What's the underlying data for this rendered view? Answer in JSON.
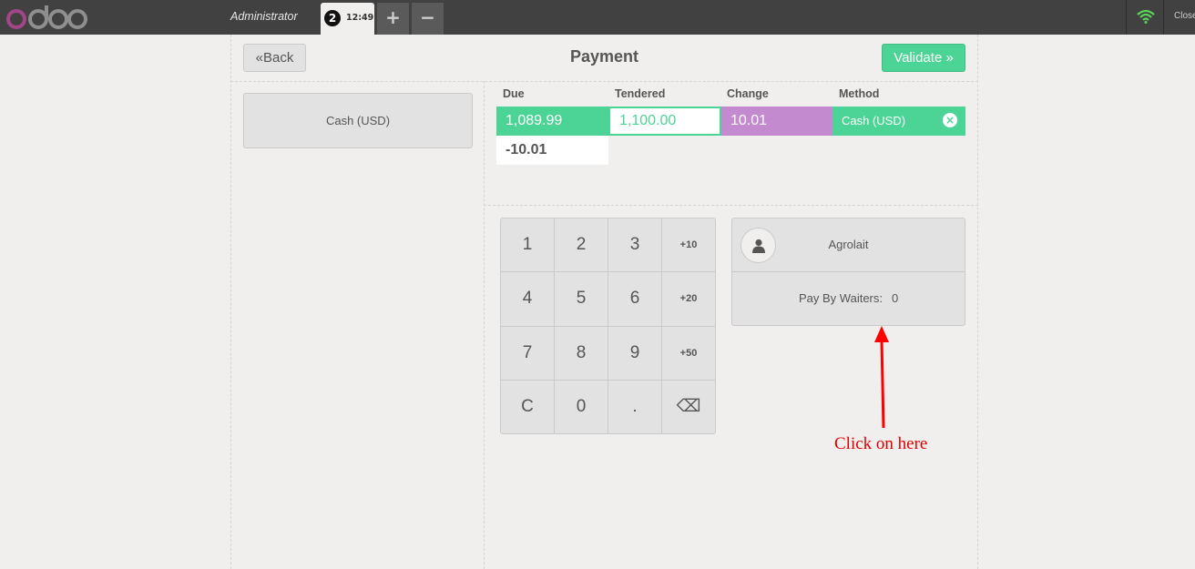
{
  "topbar": {
    "logo": "odoo",
    "cashier": "Administrator",
    "order_number": "2",
    "order_time": "12:49",
    "add_label": "+",
    "remove_label": "−",
    "close_label": "Close"
  },
  "header": {
    "back_label": "Back",
    "title": "Payment",
    "validate_label": "Validate"
  },
  "payment_methods": [
    "Cash (USD)"
  ],
  "payment_table": {
    "columns": [
      "Due",
      "Tendered",
      "Change",
      "Method"
    ],
    "line": {
      "due": "1,089.99",
      "tendered": "1,100.00",
      "change": "10.01",
      "method": "Cash (USD)"
    },
    "remaining": "-10.01"
  },
  "numpad": {
    "keys": [
      "1",
      "2",
      "3",
      "+10",
      "4",
      "5",
      "6",
      "+20",
      "7",
      "8",
      "9",
      "+50",
      "C",
      "0",
      ".",
      "⌫"
    ]
  },
  "customer": {
    "name": "Agrolait",
    "waiter_label": "Pay By Waiters:",
    "waiter_value": "0"
  },
  "annotation": {
    "text": "Click on here"
  },
  "colors": {
    "topbar": "#414141",
    "accent_green": "#4cd496",
    "change_purple": "#c48ad0",
    "annotation_red": "#e00000"
  }
}
